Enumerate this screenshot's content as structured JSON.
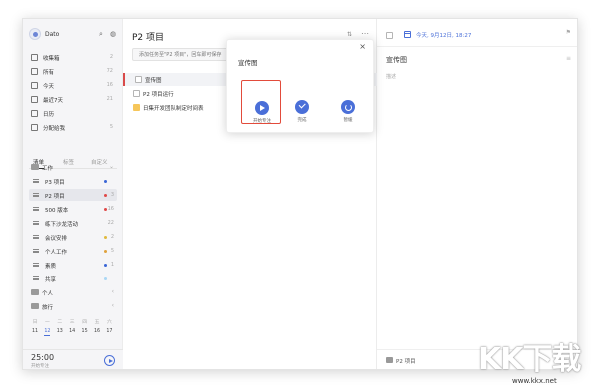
{
  "sidebar": {
    "app_name": "Dato",
    "search_icon": "search-icon",
    "bell_icon": "bell-icon",
    "smart_lists": [
      {
        "label": "收集箱",
        "count": "2",
        "icon": "inbox-icon"
      },
      {
        "label": "所有",
        "count": "72",
        "icon": "all-icon"
      },
      {
        "label": "今天",
        "count": "16",
        "icon": "today-icon"
      },
      {
        "label": "最近7天",
        "count": "21",
        "icon": "week-icon"
      },
      {
        "label": "日历",
        "count": "",
        "icon": "calendar-icon"
      },
      {
        "label": "分配给我",
        "count": "5",
        "icon": "assigned-icon"
      }
    ],
    "tabs": [
      "清单",
      "标签",
      "自定义"
    ],
    "lists": [
      {
        "label": "工作",
        "type": "folder",
        "count": "",
        "chev": "⌄"
      },
      {
        "label": "P3 项目",
        "type": "list",
        "dot": "#3a66d6",
        "count": ""
      },
      {
        "label": "P2 项目",
        "type": "list",
        "dot": "#e04848",
        "count": "3"
      },
      {
        "label": "500 版本",
        "type": "list",
        "dot": "#e04848",
        "count": "16"
      },
      {
        "label": "练下沙龙活动",
        "type": "list",
        "dot": "",
        "count": "22"
      },
      {
        "label": "会议安排",
        "type": "list",
        "dot": "#e0b93d",
        "count": "2"
      },
      {
        "label": "个人工作",
        "type": "list",
        "dot": "#e0a23d",
        "count": "5"
      },
      {
        "label": "素质",
        "type": "list",
        "dot": "#3a66d6",
        "count": "1"
      },
      {
        "label": "共享",
        "type": "list",
        "dot": "#aad7f5",
        "count": ""
      },
      {
        "label": "个人",
        "type": "folder",
        "count": "",
        "chev": "‹"
      },
      {
        "label": "旅行",
        "type": "folder",
        "count": "",
        "chev": "‹"
      }
    ],
    "mini_calendar": {
      "weekdays": [
        "日",
        "一",
        "二",
        "三",
        "四",
        "五",
        "六"
      ],
      "dates": [
        "11",
        "12",
        "13",
        "14",
        "15",
        "16",
        "17"
      ],
      "today_index": 1
    },
    "pomodoro": {
      "time": "25:00",
      "label": "开始专注"
    }
  },
  "main": {
    "title": "P2 项目",
    "add_placeholder": "添加任务至\"P2 项目\"，回车即可保存",
    "tasks": [
      {
        "title": "宣传图",
        "selected": true,
        "checkbox": "normal"
      },
      {
        "title": "P2 项目运行",
        "selected": false,
        "checkbox": "normal"
      },
      {
        "title": "日集开发团队制定时间表",
        "selected": false,
        "checkbox": "yellow"
      }
    ]
  },
  "popup": {
    "title": "宣传图",
    "close": "×",
    "actions": [
      {
        "label": "开始专注",
        "icon": "play-icon",
        "highlight": true
      },
      {
        "label": "完成",
        "icon": "check-icon",
        "highlight": false
      },
      {
        "label": "暂缓",
        "icon": "undo-icon",
        "highlight": false
      }
    ]
  },
  "detail": {
    "date": "今天, 9月12日, 18:27",
    "title": "宣传图",
    "note_placeholder": "描述",
    "list_name": "P2 项目"
  },
  "colors": {
    "accent": "#4a6fd8",
    "highlight_border": "#e24b3b"
  }
}
